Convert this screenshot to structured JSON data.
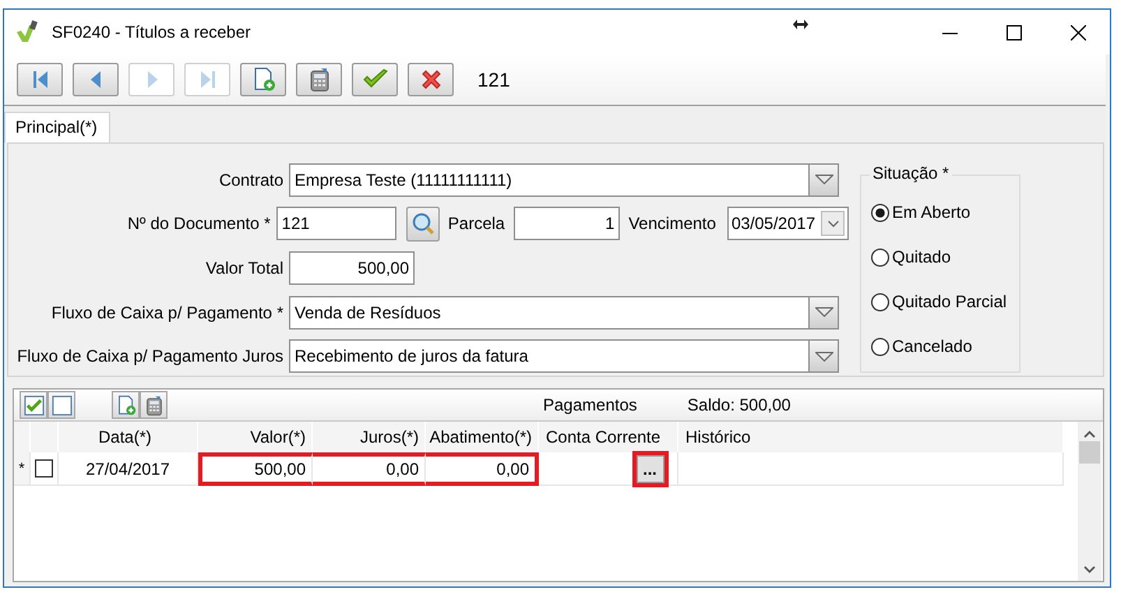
{
  "window": {
    "title": "SF0240 - Títulos a receber"
  },
  "toolbar": {
    "buttons": [
      {
        "kind": "first",
        "disabled": false
      },
      {
        "kind": "prev",
        "disabled": false
      },
      {
        "kind": "next",
        "disabled": true
      },
      {
        "kind": "last",
        "disabled": true
      },
      {
        "kind": "new",
        "disabled": false
      },
      {
        "kind": "calculator",
        "disabled": false
      },
      {
        "kind": "confirm",
        "disabled": false
      },
      {
        "kind": "cancel",
        "disabled": false
      }
    ],
    "record": "121"
  },
  "tabs": [
    {
      "label": "Principal(*)",
      "selected": true
    }
  ],
  "form": {
    "contrato": {
      "label": "Contrato",
      "value": "Empresa Teste (11111111111)"
    },
    "documento": {
      "label": "Nº do Documento *",
      "value": "121"
    },
    "parcela": {
      "label": "Parcela",
      "value": "1"
    },
    "vencimento": {
      "label": "Vencimento",
      "value": "03/05/2017"
    },
    "valor_total": {
      "label": "Valor Total",
      "value": "500,00"
    },
    "fluxo_pagamento": {
      "label": "Fluxo de Caixa p/ Pagamento *",
      "value": "Venda de Resíduos"
    },
    "fluxo_juros": {
      "label": "Fluxo de Caixa p/ Pagamento Juros",
      "value": "Recebimento de juros da fatura"
    }
  },
  "situacao": {
    "title": "Situação *",
    "options": [
      {
        "label": "Em Aberto",
        "selected": true
      },
      {
        "label": "Quitado",
        "selected": false
      },
      {
        "label": "Quitado Parcial",
        "selected": false
      },
      {
        "label": "Cancelado",
        "selected": false
      }
    ]
  },
  "payments": {
    "toolbar": [
      {
        "kind": "check-all"
      },
      {
        "kind": "uncheck-all"
      },
      {
        "kind": "new"
      },
      {
        "kind": "calculator"
      }
    ],
    "title": "Pagamentos",
    "saldo": "Saldo: 500,00",
    "columns": [
      "Data(*)",
      "Valor(*)",
      "Juros(*)",
      "Abatimento(*)",
      "Conta Corrente",
      "Histórico"
    ],
    "rows": [
      {
        "marker": "*",
        "checked": false,
        "cells": [
          {
            "kind": "text",
            "text": "27/04/2017",
            "highlighted": false
          },
          {
            "kind": "text",
            "text": "500,00",
            "highlighted": true
          },
          {
            "kind": "text",
            "text": "0,00",
            "highlighted": true
          },
          {
            "kind": "text",
            "text": "0,00",
            "highlighted": true
          },
          {
            "kind": "button",
            "text": "...",
            "highlighted": true
          },
          {
            "kind": "text",
            "text": "",
            "highlighted": false
          }
        ]
      }
    ]
  }
}
